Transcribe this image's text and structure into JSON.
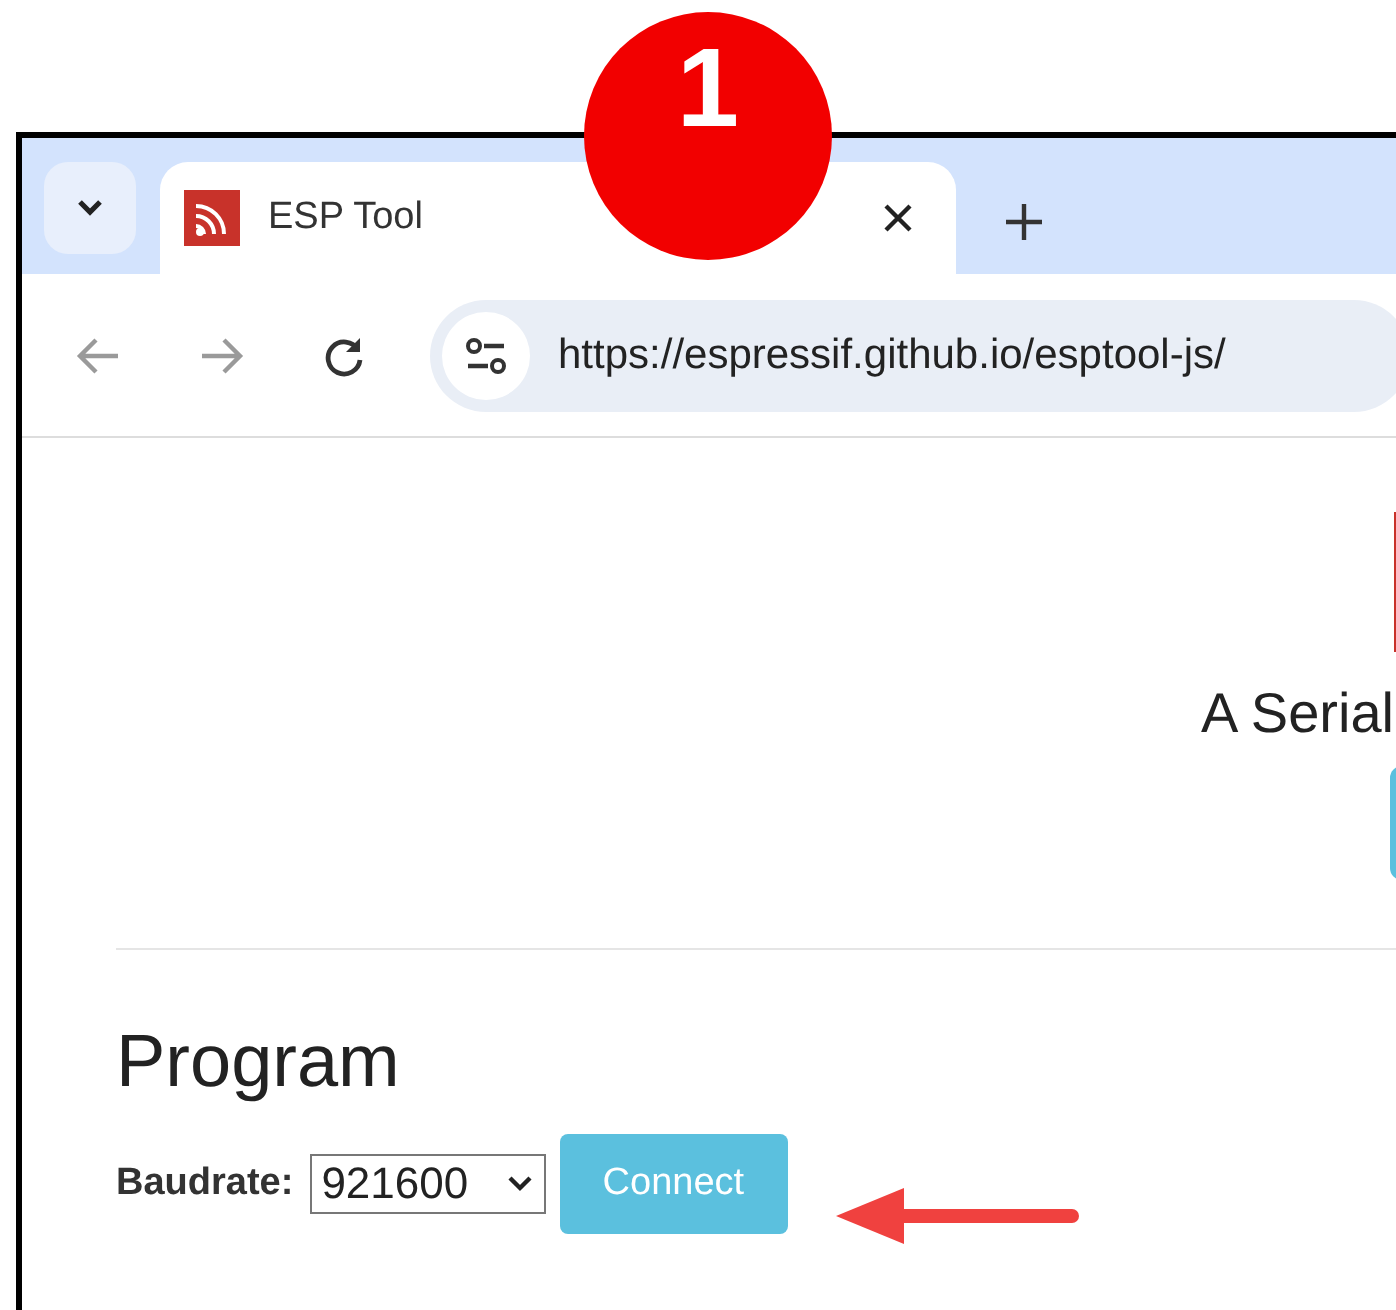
{
  "browser": {
    "tab": {
      "title": "ESP Tool",
      "selected": true
    },
    "address": "https://espressif.github.io/esptool-js/"
  },
  "page": {
    "subtitle": "A Serial",
    "section_title": "Program",
    "baudrate_label": "Baudrate:",
    "baudrate_value": "921600",
    "connect_button": "Connect"
  },
  "annotation": {
    "step": "1"
  }
}
